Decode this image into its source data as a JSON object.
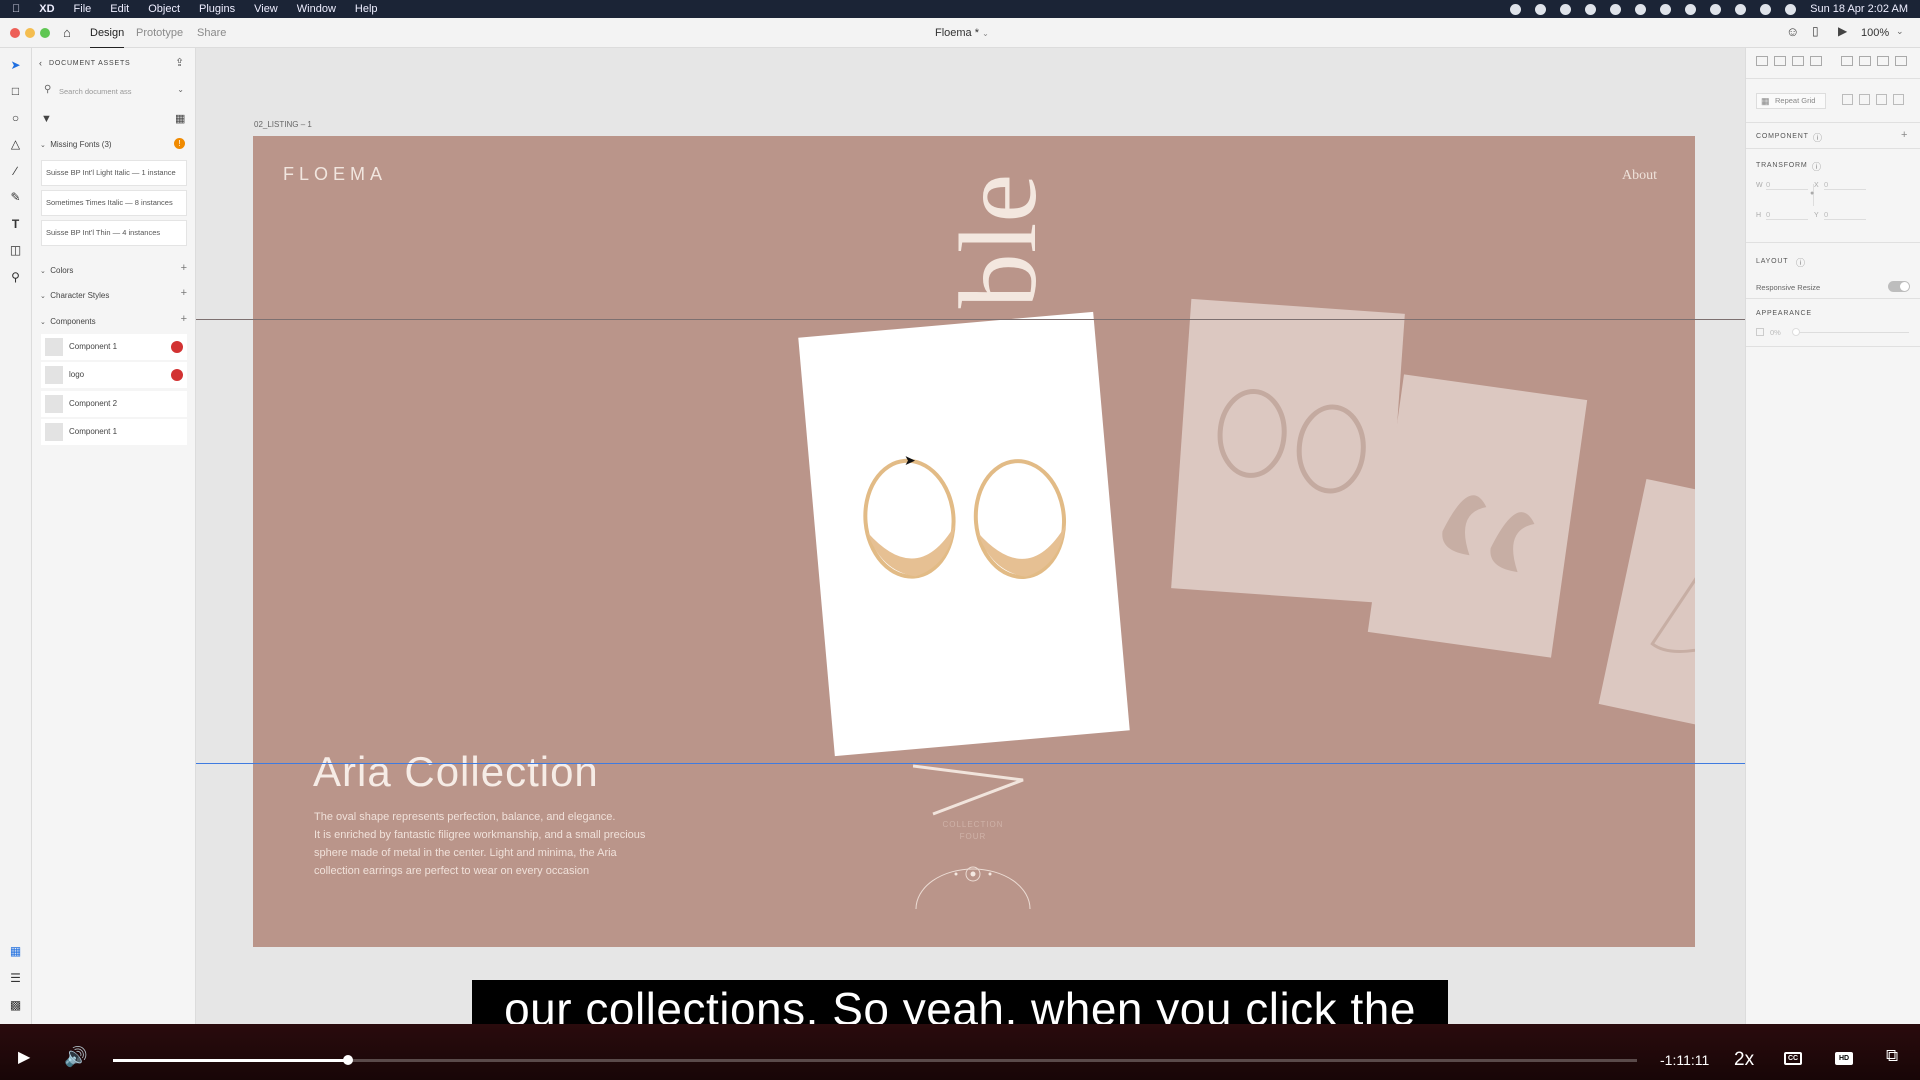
{
  "menubar": {
    "app": "XD",
    "items": [
      "File",
      "Edit",
      "Object",
      "Plugins",
      "View",
      "Window",
      "Help"
    ],
    "datetime": "Sun 18 Apr  2:02 AM"
  },
  "titlebar": {
    "tabs": [
      "Design",
      "Prototype",
      "Share"
    ],
    "doc_title": "Floema *",
    "zoom": "100%"
  },
  "assets": {
    "header": "DOCUMENT ASSETS",
    "search_placeholder": "Search document ass",
    "missing_fonts": {
      "label": "Missing Fonts (3)",
      "items": [
        "Suisse BP Int'l Light Italic — 1 instance",
        "Sometimes Times Italic — 8 instances",
        "Suisse BP Int'l Thin — 4 instances"
      ]
    },
    "colors_label": "Colors",
    "char_styles_label": "Character Styles",
    "components_label": "Components",
    "components": [
      "Component 1",
      "logo",
      "Component 2",
      "Component 1"
    ]
  },
  "canvas": {
    "artboard_name": "02_LISTING – 1",
    "logo": "FLOEMA",
    "nav_about": "About",
    "big_word": "ble",
    "collection_title": "Aria Collection",
    "description": [
      "The oval shape represents perfection, balance, and elegance.",
      "It is enriched by fantastic filigree workmanship, and a small precious",
      "sphere made of metal in the center. Light and minima, the Aria",
      "collection earrings are perfect to wear on every occasion"
    ],
    "collection_line1": "COLLECTION",
    "collection_line2": "FOUR"
  },
  "props": {
    "repeat_grid": "Repeat Grid",
    "component": "COMPONENT",
    "transform": "TRANSFORM",
    "w_label": "W",
    "w_value": "0",
    "x_label": "X",
    "x_value": "0",
    "h_label": "H",
    "h_value": "0",
    "y_label": "Y",
    "y_value": "0",
    "layout": "LAYOUT",
    "responsive_resize": "Responsive Resize",
    "appearance": "APPEARANCE",
    "opacity": "0%"
  },
  "video": {
    "caption": "our collections. So yeah, when you click the",
    "timecode": "-1:11:11",
    "speed": "2x",
    "progress": 0.154
  },
  "colors": {
    "artboard": "#ba958a",
    "guide_gray": "#7d7070",
    "guide_blue": "#3f7be0",
    "accent_red": "#d23232"
  }
}
